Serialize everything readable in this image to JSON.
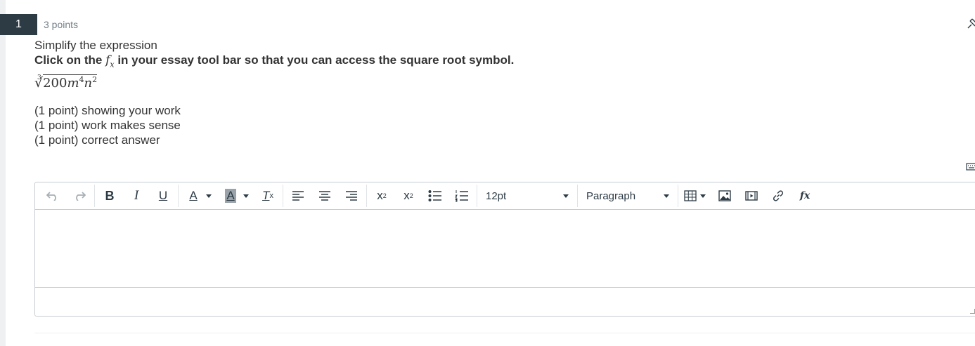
{
  "question": {
    "number": "1",
    "points": "3 points",
    "intro": "Simplify the expression",
    "instruction_before": "Click on the ",
    "fx_symbol": "f",
    "fx_sub": "x",
    "instruction_after": " in your essay tool bar so that you can access the square root symbol.",
    "expression": {
      "root_index": "3",
      "radicand_coef": "200",
      "var1": "m",
      "exp1": "4",
      "var2": "n",
      "exp2": "2"
    },
    "rubric": [
      "(1 point) showing your work",
      "(1 point) work makes sense",
      "(1 point) correct answer"
    ]
  },
  "toolbar": {
    "font_size": "12pt",
    "block_format": "Paragraph",
    "bold": "B",
    "italic": "I",
    "underline": "U",
    "text_color": "A",
    "highlight": "A",
    "clear_format": "T",
    "clear_format_sub": "x",
    "superscript_base": "x",
    "superscript_mark": "2",
    "subscript_base": "x",
    "subscript_mark": "2",
    "equation": "fx"
  },
  "icons": {
    "pin": "pin-icon",
    "keyboard": "keyboard-icon",
    "undo": "undo-icon",
    "redo": "redo-icon",
    "align_left": "align-left-icon",
    "align_center": "align-center-icon",
    "align_right": "align-right-icon",
    "bullet_list": "bullet-list-icon",
    "numbered_list": "numbered-list-icon",
    "table": "table-icon",
    "image": "image-icon",
    "media": "media-icon",
    "link": "link-icon"
  },
  "colors": {
    "question_number_bg": "#2d3b45",
    "text": "#333333",
    "muted": "#73818a",
    "border": "#c7cdd1"
  }
}
